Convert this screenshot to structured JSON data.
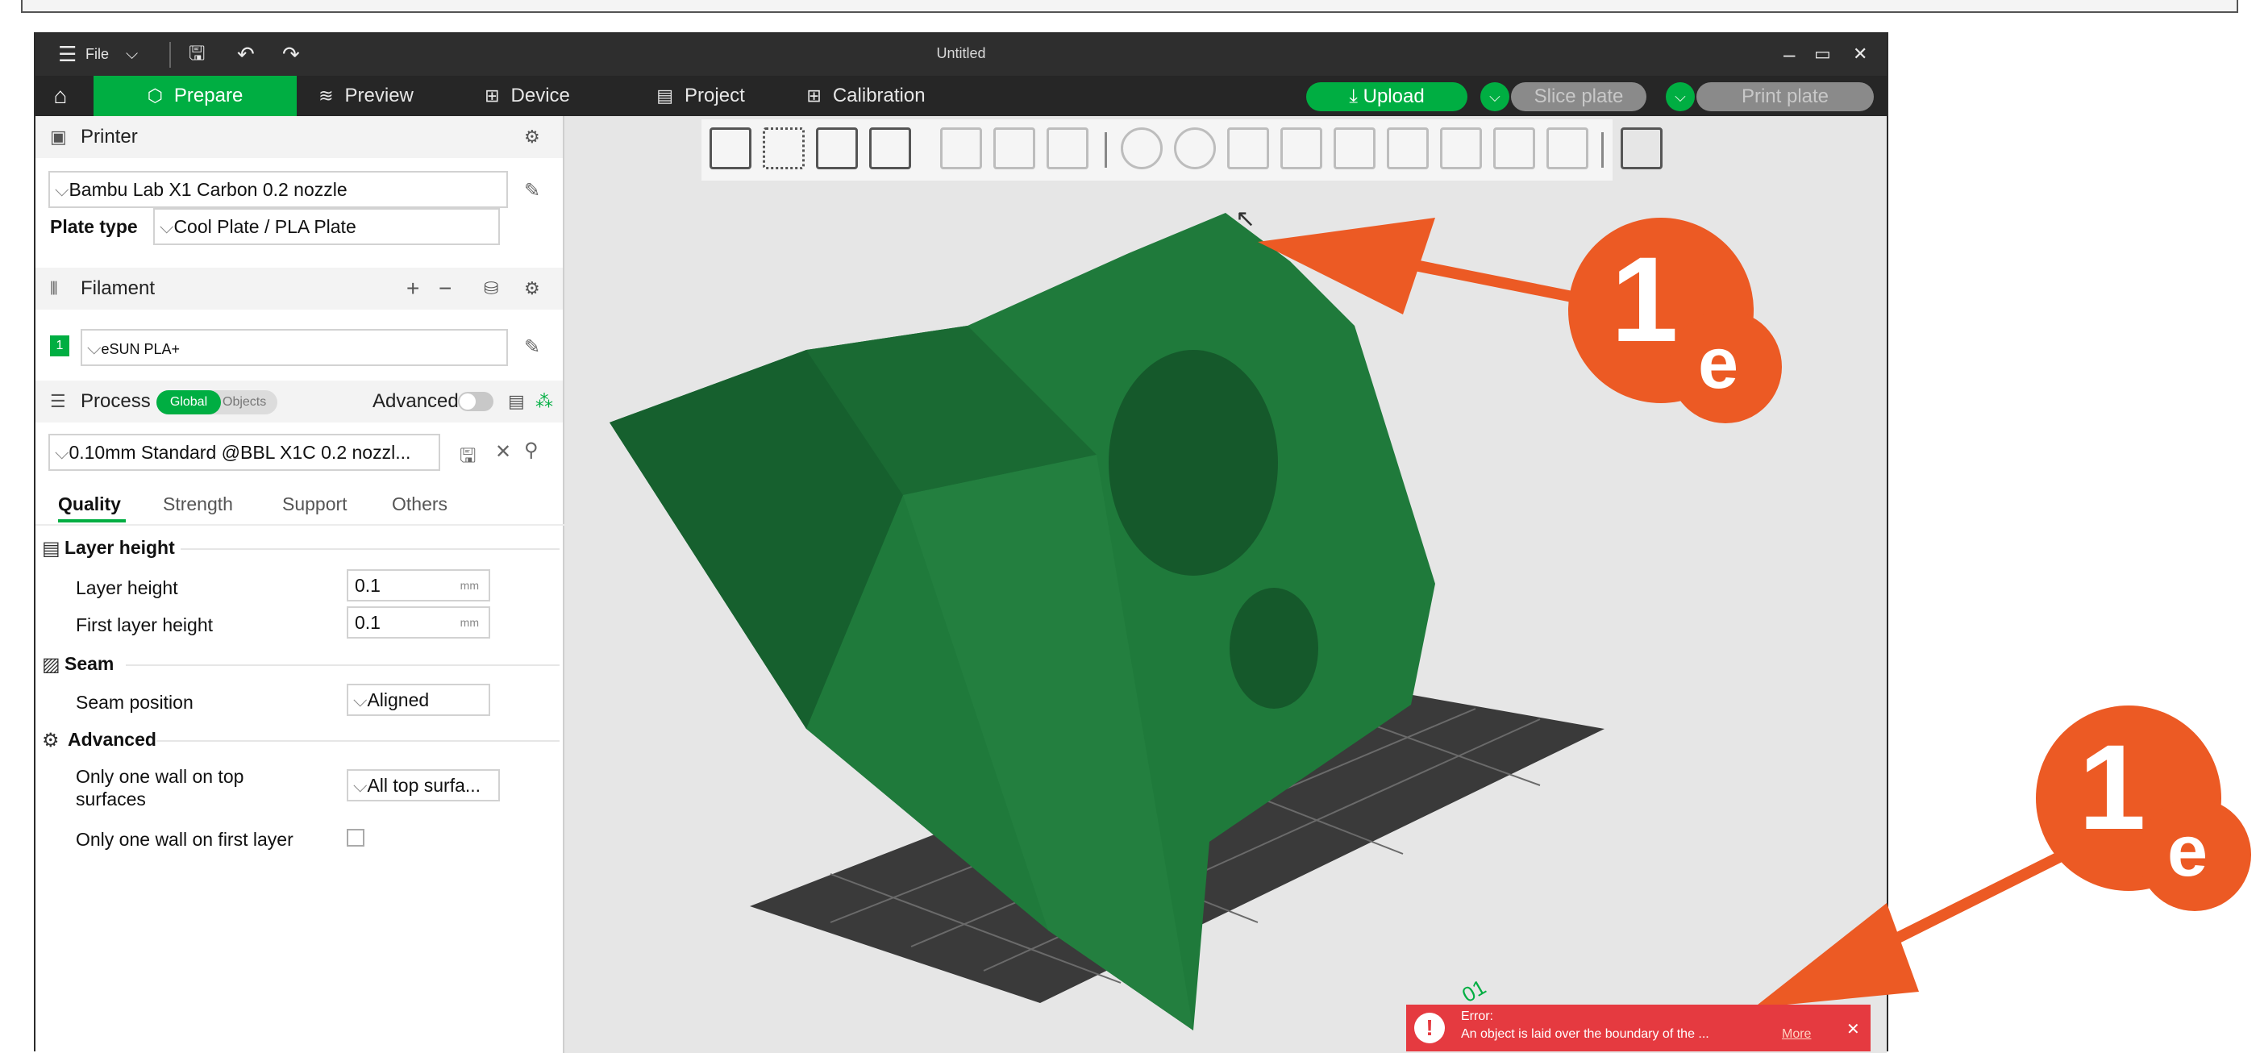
{
  "window": {
    "file_menu": "File",
    "title": "Untitled"
  },
  "nav": {
    "tabs": [
      {
        "label": "Prepare"
      },
      {
        "label": "Preview"
      },
      {
        "label": "Device"
      },
      {
        "label": "Project"
      },
      {
        "label": "Calibration"
      }
    ],
    "upload": "Upload",
    "slice_plate": "Slice plate",
    "print_plate": "Print plate"
  },
  "printer": {
    "section_title": "Printer",
    "model": "Bambu Lab X1 Carbon 0.2 nozzle",
    "plate_type_label": "Plate type",
    "plate_type_value": "Cool Plate / PLA Plate"
  },
  "filament": {
    "section_title": "Filament",
    "slot_number": "1",
    "value": "eSUN PLA+"
  },
  "process": {
    "section_title": "Process",
    "toggle_global": "Global",
    "toggle_objects": "Objects",
    "advanced_label": "Advanced",
    "preset": "0.10mm Standard @BBL X1C 0.2 nozzl...",
    "tabs": [
      "Quality",
      "Strength",
      "Support",
      "Others"
    ],
    "groups": {
      "layer_height": {
        "title": "Layer height",
        "layer_height_label": "Layer height",
        "layer_height_value": "0.1",
        "first_layer_label": "First layer height",
        "first_layer_value": "0.1",
        "unit": "mm"
      },
      "seam": {
        "title": "Seam",
        "seam_position_label": "Seam position",
        "seam_position_value": "Aligned"
      },
      "advanced": {
        "title": "Advanced",
        "one_wall_top_label_line1": "Only one wall on top",
        "one_wall_top_label_line2": "surfaces",
        "one_wall_top_value": "All top surfa...",
        "one_wall_first_label": "Only one wall on first layer"
      }
    }
  },
  "error": {
    "title": "Error:",
    "message": "An object is laid over the boundary of the ...",
    "more": "More"
  },
  "annotations": {
    "main": "1",
    "sub": "e"
  },
  "colors": {
    "accent": "#00ae42",
    "model_green": "#1f7a3b",
    "annotation_orange": "#ec5a24",
    "error_red": "#e53a40"
  }
}
